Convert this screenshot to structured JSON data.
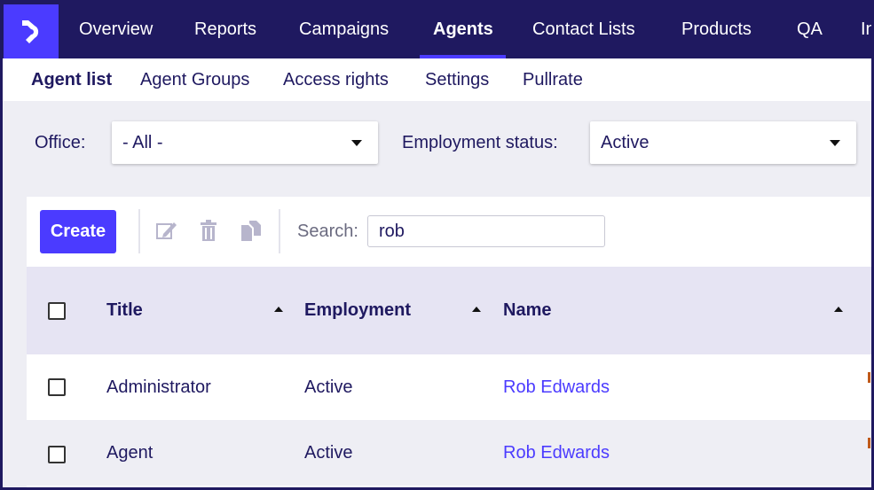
{
  "top_nav": {
    "items": [
      "Overview",
      "Reports",
      "Campaigns",
      "Agents",
      "Contact Lists",
      "Products",
      "QA",
      "In"
    ],
    "active": "Agents"
  },
  "sub_nav": {
    "items": [
      "Agent list",
      "Agent Groups",
      "Access rights",
      "Settings",
      "Pullrate"
    ],
    "active": "Agent list"
  },
  "filters": {
    "office_label": "Office:",
    "office_value": "- All -",
    "employment_label": "Employment status:",
    "employment_value": "Active"
  },
  "toolbar": {
    "create_label": "Create",
    "search_label": "Search:",
    "search_value": "rob"
  },
  "table": {
    "headers": [
      "Title",
      "Employment",
      "Name"
    ],
    "rows": [
      {
        "title": "Administrator",
        "employment": "Active",
        "name": "Rob Edwards"
      },
      {
        "title": "Agent",
        "employment": "Active",
        "name": "Rob Edwards"
      }
    ]
  },
  "colors": {
    "nav_bg": "#1f1960",
    "accent": "#4b3bff",
    "header_bg": "#e6e4f3"
  }
}
